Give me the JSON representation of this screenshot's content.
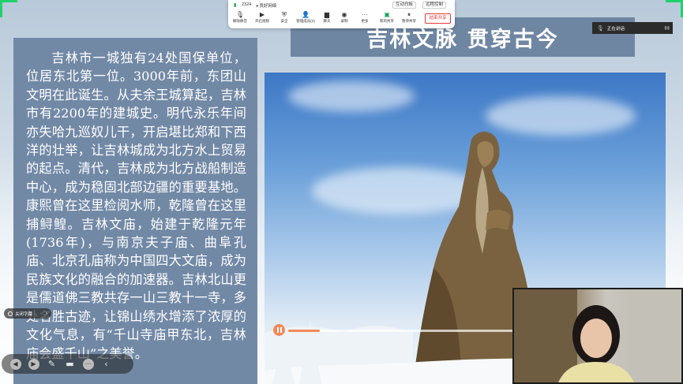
{
  "toolbar": {
    "signal_icon": "signal-bars-icon",
    "meeting_id": "2324",
    "network_status": "良好网络",
    "pill_interaction": "互动白板",
    "pill_remote": "远程控制",
    "items": [
      {
        "icon": "microphone-icon",
        "label": "解除静音"
      },
      {
        "icon": "video-camera-icon",
        "label": "开启视频"
      },
      {
        "icon": "shield-icon",
        "label": "安全"
      },
      {
        "icon": "participants-icon",
        "label": "管理成员(2)"
      },
      {
        "icon": "chat-icon",
        "label": "聊天"
      },
      {
        "icon": "record-icon",
        "label": "录制"
      },
      {
        "icon": "more-icon",
        "label": "更多"
      },
      {
        "icon": "share-screen-icon",
        "label": "新的共享"
      },
      {
        "icon": "pause-share-icon",
        "label": "暂停共享"
      }
    ],
    "exit_label": "结束共享"
  },
  "user_tile": {
    "name": "正在讲话:",
    "mic_icon": "microphone-icon"
  },
  "slide": {
    "title": "吉林文脉 贯穿古今",
    "body": "吉林市一城独有24处国保单位，位居东北第一位。3000年前，东团山文明在此诞生。从夫余王城算起，吉林市有2200年的建城史。明代永乐年间亦失哈九巡奴儿干，开启堪比郑和下西洋的壮举，让吉林城成为北方水上贸易的起点。清代，吉林成为北方战船制造中心，成为稳固北部边疆的重要基地。康熙曾在这里检阅水师，乾隆曾在这里捕鲟鳇。吉林文庙，始建于乾隆元年(1736年)，与南京夫子庙、曲阜孔庙、北京孔庙称为中国四大文庙，成为民族文化的融合的加速器。吉林北山更是儒道佛三教共存一山三教十一寺，多处名胜古迹，让锦山绣水增添了浓厚的文化气息，有“千山寺庙甲东北，吉林庙会盛千山”之美誉。"
  },
  "video": {
    "progress": 0.14,
    "pause_icon": "pause-icon"
  },
  "controls": {
    "caption_label": "关闭字幕",
    "bottom": [
      {
        "icon": "previous-icon"
      },
      {
        "icon": "next-icon"
      },
      {
        "icon": "pen-icon"
      },
      {
        "icon": "screen-icon"
      },
      {
        "icon": "more-icon"
      },
      {
        "icon": "chevron-left-icon"
      }
    ]
  },
  "colors": {
    "panel": "#7289a6",
    "title_bg": "#6f86a3",
    "accent_green": "#1fd16b",
    "progress": "#f28a5a",
    "exit": "#e53935"
  }
}
